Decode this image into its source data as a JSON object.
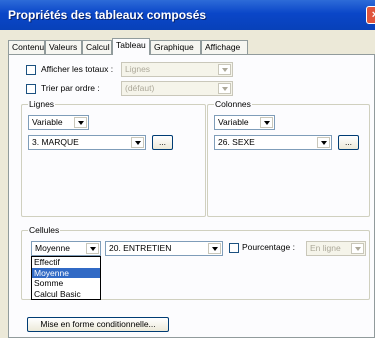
{
  "window": {
    "title": "Propriétés des tableaux composés",
    "close_glyph": "×"
  },
  "tabs": [
    {
      "label": "Contenu"
    },
    {
      "label": "Valeurs"
    },
    {
      "label": "Calcul"
    },
    {
      "label": "Tableau",
      "active": true
    },
    {
      "label": "Graphique"
    },
    {
      "label": "Affichage"
    }
  ],
  "options": {
    "totaux_label": "Afficher les totaux :",
    "totaux_value": "Lignes",
    "trier_label": "Trier par ordre :",
    "trier_value": "(défaut)"
  },
  "lignes": {
    "title": "Lignes",
    "type_value": "Variable",
    "variable_value": "3. MARQUE",
    "browse_label": "..."
  },
  "colonnes": {
    "title": "Colonnes",
    "type_value": "Variable",
    "variable_value": "26. SEXE",
    "browse_label": "..."
  },
  "cellules": {
    "title": "Cellules",
    "type_value": "Moyenne",
    "variable_value": "20. ENTRETIEN",
    "pourcentage_label": "Pourcentage :",
    "pourcentage_value": "En ligne",
    "dropdown_options": [
      "Effectif",
      "Moyenne",
      "Somme",
      "Calcul Basic"
    ],
    "dropdown_selected": "Moyenne"
  },
  "footer": {
    "mise_en_forme_label": "Mise en forme conditionnelle..."
  },
  "colors": {
    "titlebar": "#0a46c8",
    "selection": "#316ac5"
  },
  "icons": [
    "close-icon",
    "chevron-down-icon",
    "checkbox-icon"
  ]
}
